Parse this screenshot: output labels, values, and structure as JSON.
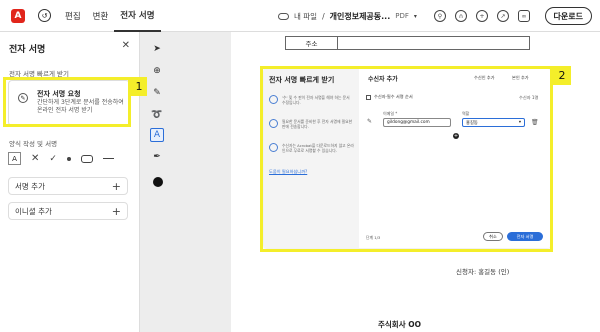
{
  "topbar": {
    "logo": "A",
    "menu": [
      "편집",
      "변환",
      "전자 서명"
    ],
    "active_tab": "전자 서명",
    "breadcrumb_parent": "내 파일",
    "file_name": "개인정보제공동...",
    "file_ext": "PDF",
    "download_label": "다운로드"
  },
  "left_panel": {
    "title": "전자 서명",
    "section1": "전자 서명 빠르게 받기",
    "request_title": "전자 서명 요청",
    "request_desc": "간단하게 3단계로 문서를 전송하여 온라인 전자 서명 받기",
    "section2": "양식 작성 및 서명",
    "tool_text_label": "A",
    "add_signature": "서명 추가",
    "add_initials": "이니셜 추가"
  },
  "annotations": {
    "badge1": "1",
    "badge2": "2"
  },
  "document": {
    "table_cell": "주소",
    "applicant": "신청자: 홍길동 (인)",
    "company": "주식회사 OO"
  },
  "dialog": {
    "left_title": "전자 서명 빠르게 받기",
    "steps": [
      "'수' 및 수 판이 전자 서명을 해야 하는 문서 수정입니다.",
      "필요한 문서를 준비한 후 전자 서명에 필요한 판에 전송합니다.",
      "수신자는 Acrobat을 다운로드하지 않고 온라인으로 무료로 서명할 수 있습니다."
    ],
    "help_link": "도움이 필요하십니까?",
    "right_title": "수신자 추가",
    "link_add_recipient": "수신인 추가",
    "link_add_me": "본인 추가",
    "checkbox_label": "수신자·필수 서명 순서",
    "recipient_count": "수신자 1명",
    "email_label": "이메일 *",
    "role_label": "역할",
    "email_value": "gildong@gmail.com",
    "role_value": "홍길동",
    "step_indicator": "단계 1/3",
    "cancel_label": "취소",
    "send_label": "전자 서명"
  },
  "colors": {
    "highlight": "#f4ee2a",
    "accent": "#2b6ed8",
    "brand": "#e1251b"
  }
}
